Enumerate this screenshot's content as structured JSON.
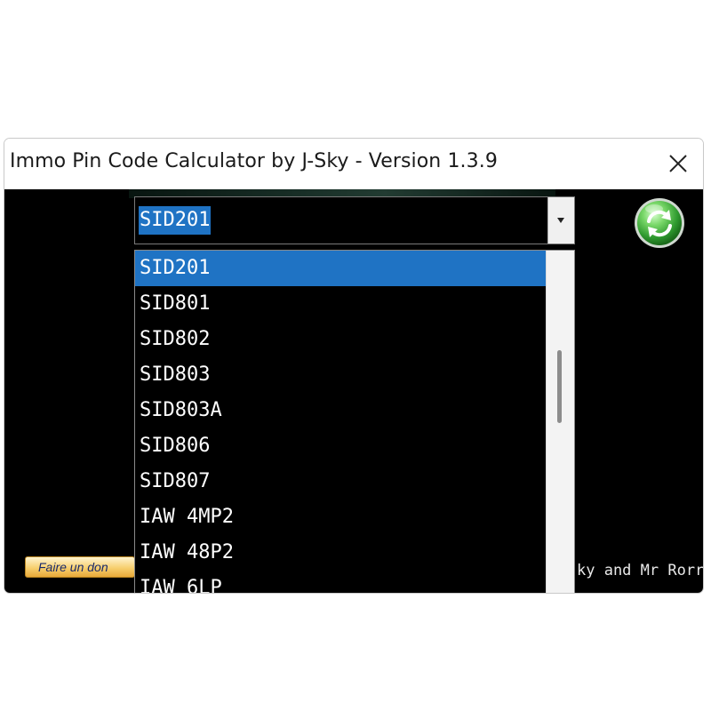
{
  "window": {
    "title": "Immo Pin Code Calculator by J-Sky  -  Version 1.3.9",
    "close_icon": "close-icon"
  },
  "combo": {
    "selected_value": "SID201",
    "arrow_icon": "triangle-down-icon"
  },
  "refresh_button": {
    "icon": "refresh-icon",
    "color": "#3fb43f"
  },
  "dropdown": {
    "selected_index": 0,
    "items": [
      "SID201",
      "SID801",
      "SID802",
      "SID803",
      "SID803A",
      "SID806",
      "SID807",
      "IAW 4MP2",
      "IAW 48P2",
      "IAW 6LP"
    ]
  },
  "footer": {
    "donate_label": "Faire un don",
    "credit_text": "ky and Mr Rorry"
  },
  "colors": {
    "selection": "#1f73c4",
    "background": "#000000",
    "text": "#ffffff"
  }
}
